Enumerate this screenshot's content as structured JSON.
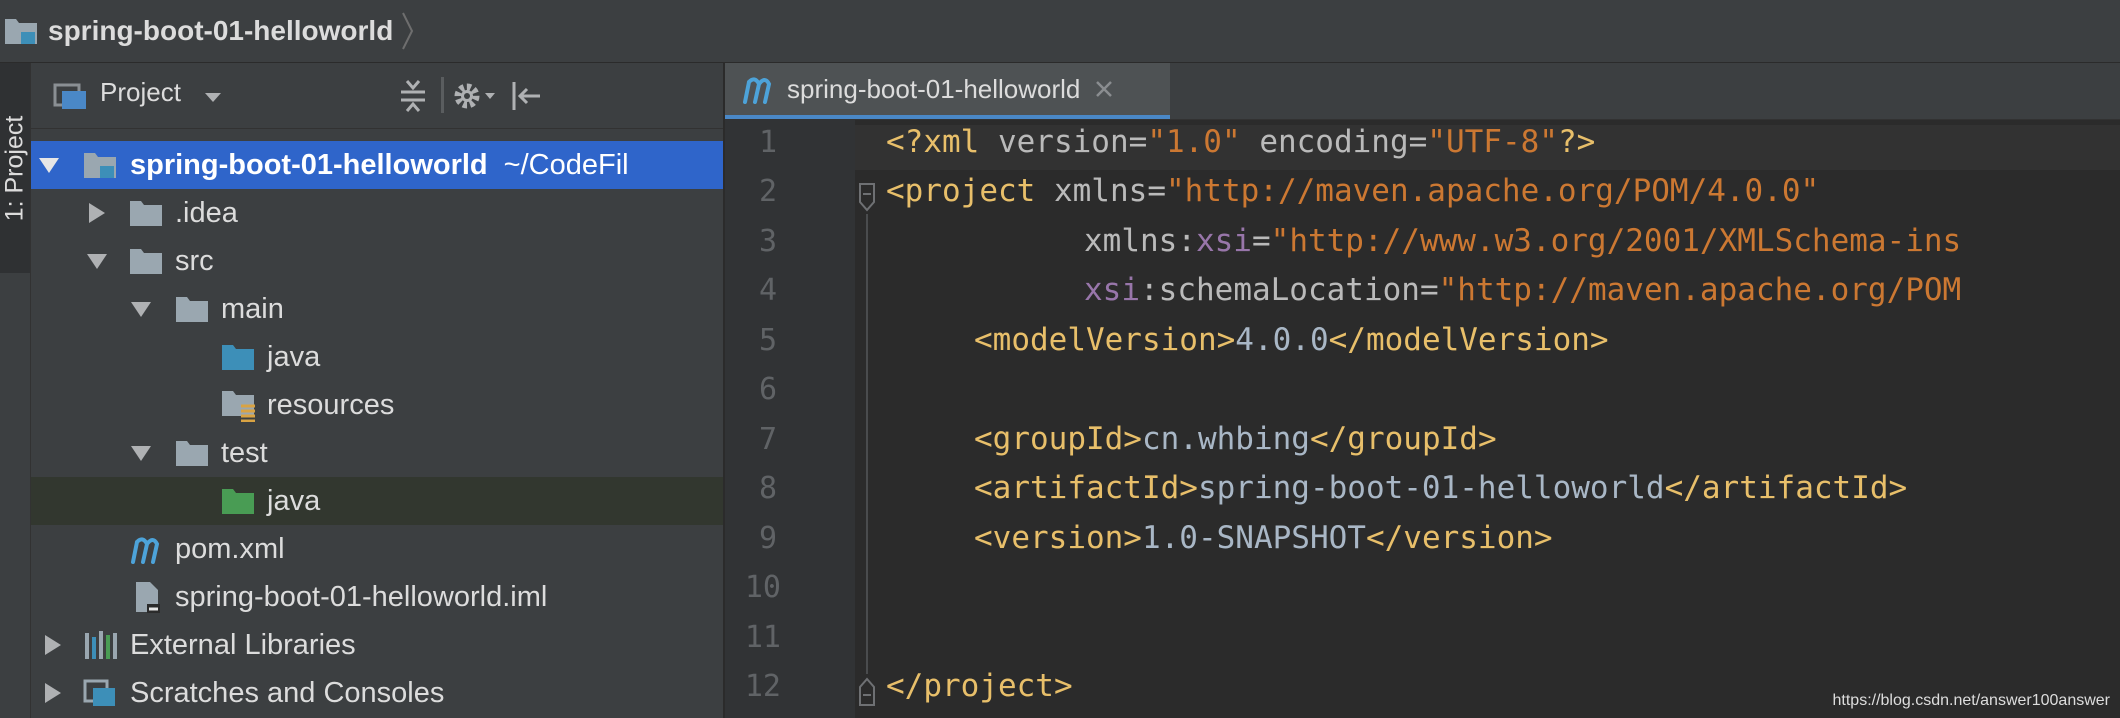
{
  "navbar": {
    "breadcrumb": "spring-boot-01-helloworld"
  },
  "tool_strip": {
    "project_tab": "1: Project"
  },
  "project_panel": {
    "view_selector": "Project",
    "tree": [
      {
        "label": "spring-boot-01-helloworld",
        "path": "~/CodeFil",
        "kind": "module",
        "expanded": true,
        "selected": true
      },
      {
        "label": ".idea",
        "kind": "folder",
        "expanded": false
      },
      {
        "label": "src",
        "kind": "folder",
        "expanded": true
      },
      {
        "label": "main",
        "kind": "folder",
        "expanded": true
      },
      {
        "label": "java",
        "kind": "source-folder"
      },
      {
        "label": "resources",
        "kind": "resources-folder"
      },
      {
        "label": "test",
        "kind": "folder",
        "expanded": true
      },
      {
        "label": "java",
        "kind": "test-folder",
        "highlighted": true
      },
      {
        "label": "pom.xml",
        "kind": "maven-file"
      },
      {
        "label": "spring-boot-01-helloworld.iml",
        "kind": "iml-file"
      },
      {
        "label": "External Libraries",
        "kind": "libraries",
        "expanded": false
      },
      {
        "label": "Scratches and Consoles",
        "kind": "scratches",
        "expanded": false
      }
    ]
  },
  "editor": {
    "tab_label": "spring-boot-01-helloworld",
    "line_numbers": [
      "1",
      "2",
      "3",
      "4",
      "5",
      "6",
      "7",
      "8",
      "9",
      "10",
      "11",
      "12"
    ],
    "code": {
      "l1": {
        "a": "<?xml ",
        "b": "version",
        "c": "=",
        "d": "\"1.0\"",
        "e": " ",
        "f": "encoding",
        "g": "=",
        "h": "\"UTF-8\"",
        "i": "?>"
      },
      "l2": {
        "a": "<project ",
        "b": "xmlns",
        "c": "=",
        "d": "\"http://maven.apache.org/POM/4.0.0\""
      },
      "l3": {
        "a": "xmlns:",
        "b": "xsi",
        "c": "=",
        "d": "\"http://www.w3.org/2001/XMLSchema-ins"
      },
      "l4": {
        "a": "xsi",
        "b": ":schemaLocation",
        "c": "=",
        "d": "\"http://maven.apache.org/POM"
      },
      "l5": {
        "a": "<modelVersion>",
        "b": "4.0.0",
        "c": "</modelVersion>"
      },
      "l7": {
        "a": "<groupId>",
        "b": "cn.whbing",
        "c": "</groupId>"
      },
      "l8": {
        "a": "<artifactId>",
        "b": "spring-boot-01-helloworld",
        "c": "</artifactId>"
      },
      "l9": {
        "a": "<version>",
        "b": "1.0-SNAPSHOT",
        "c": "</version>"
      },
      "l12": {
        "a": "</project>"
      }
    }
  },
  "watermark": "https://blog.csdn.net/answer100answer",
  "colors": {
    "selection": "#2f65ca",
    "tab_accent": "#4a88c7",
    "folder": "#9aa7b0",
    "source_folder": "#3d8fb8",
    "test_folder": "#499c54",
    "maven_m": "#4da3d9"
  }
}
